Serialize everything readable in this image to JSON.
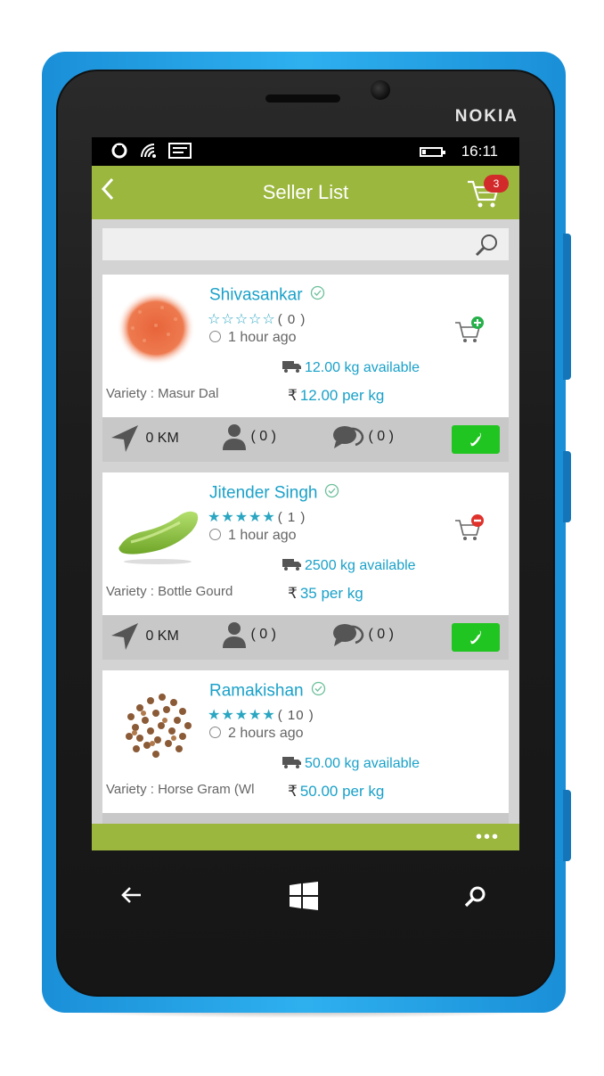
{
  "device": {
    "brand": "NOKIA"
  },
  "status": {
    "time": "16:11",
    "battery_level": 0.2
  },
  "header": {
    "title": "Seller List",
    "cart_count": "3"
  },
  "search": {
    "placeholder": "",
    "value": ""
  },
  "sellers": [
    {
      "name": "Shivasankar",
      "rating": 0,
      "rating_count": "( 0 )",
      "time_ago": "1 hour ago",
      "available": "12.00 kg available",
      "price": "12.00 per kg",
      "variety": "Variety : Masur Dal",
      "distance": "0 KM",
      "followers": "( 0 )",
      "comments": "( 0 )",
      "cart_action": "add"
    },
    {
      "name": "Jitender Singh",
      "rating": 5,
      "rating_count": "( 1 )",
      "time_ago": "1 hour ago",
      "available": "2500 kg available",
      "price": "35 per kg",
      "variety": "Variety : Bottle Gourd",
      "distance": "0 KM",
      "followers": "( 0 )",
      "comments": "( 0 )",
      "cart_action": "remove"
    },
    {
      "name": "Ramakishan",
      "rating": 5,
      "rating_count": "( 10 )",
      "time_ago": "2 hours ago",
      "available": "50.00 kg available",
      "price": "50.00 per kg",
      "variety": "Variety : Horse Gram (Wl",
      "distance": "",
      "followers": "",
      "comments": "",
      "cart_action": ""
    }
  ],
  "currency_symbol": "₹",
  "colors": {
    "header": "#9bb73e",
    "accent": "#1aa1c9",
    "call": "#21c521",
    "badge": "#d22a2a",
    "phone": "#2eb0ef"
  }
}
